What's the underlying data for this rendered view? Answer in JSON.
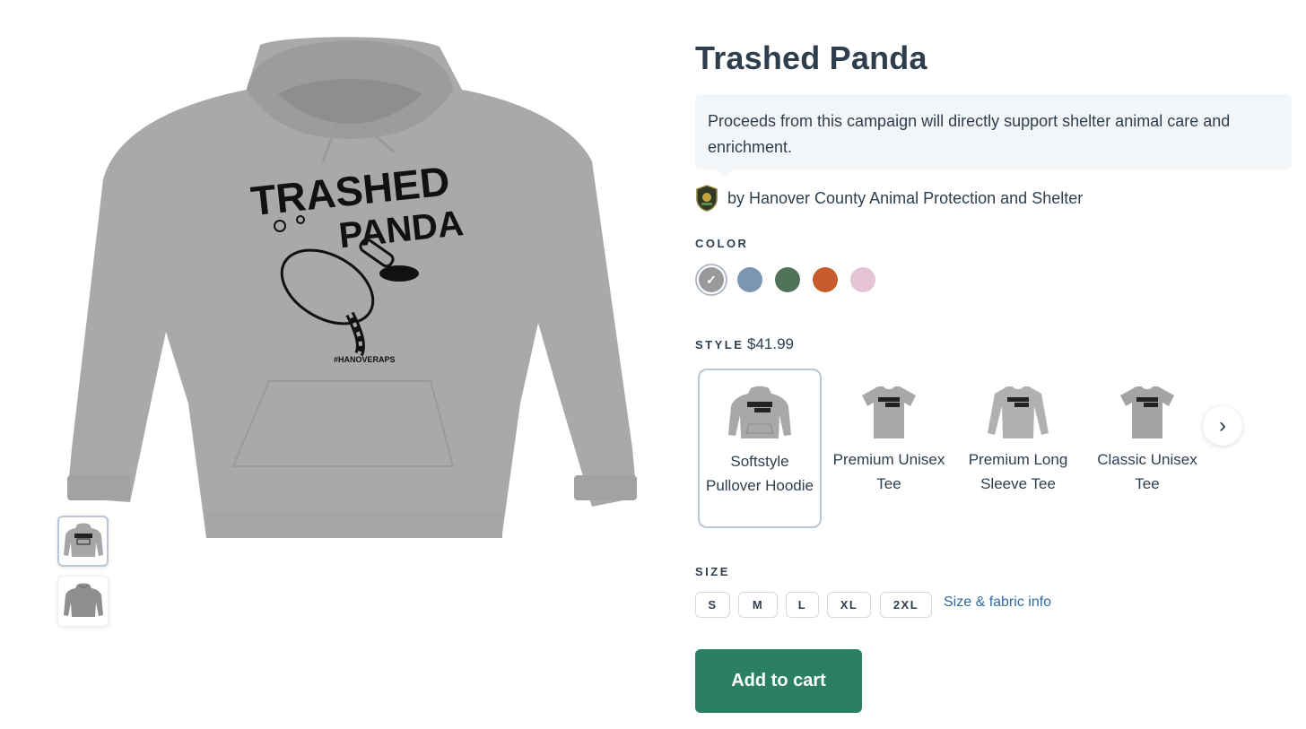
{
  "product": {
    "title": "Trashed Panda",
    "campaign_text": "Proceeds from this campaign will directly support shelter animal care and enrichment.",
    "organization": "by Hanover County Animal Protection and Shelter",
    "artwork_lines": [
      "TRASHED",
      "PANDA"
    ],
    "artwork_hashtag": "#HANOVERAPS"
  },
  "color": {
    "label": "COLOR",
    "swatches": [
      {
        "name": "gray",
        "hex": "#9a9a9d",
        "selected": true
      },
      {
        "name": "blue",
        "hex": "#7a96b1",
        "selected": false
      },
      {
        "name": "green",
        "hex": "#4e7358",
        "selected": false
      },
      {
        "name": "orange",
        "hex": "#c65c2e",
        "selected": false
      },
      {
        "name": "pink",
        "hex": "#e6c3d4",
        "selected": false
      }
    ],
    "selected_check": "✓"
  },
  "style": {
    "label": "STYLE",
    "price": "$41.99",
    "options": [
      {
        "name": "Softstyle Pullover Hoodie",
        "selected": true
      },
      {
        "name": "Premium Unisex Tee",
        "selected": false
      },
      {
        "name": "Premium Long Sleeve Tee",
        "selected": false
      },
      {
        "name": "Classic Unisex Tee",
        "selected": false
      }
    ],
    "next_icon": "›"
  },
  "size": {
    "label": "SIZE",
    "options": [
      "S",
      "M",
      "L",
      "XL",
      "2XL"
    ],
    "info_link": "Size & fabric info"
  },
  "cart": {
    "label": "Add to cart"
  },
  "colors": {
    "text": "#2f3e4d",
    "accent": "#2b8063",
    "link": "#2f6aa3",
    "panel": "#f2f6f9",
    "garment": "#a9a9ab"
  },
  "icons": {
    "next": "chevron-right-icon",
    "check": "check-icon",
    "org_logo": "shelter-badge-icon"
  }
}
